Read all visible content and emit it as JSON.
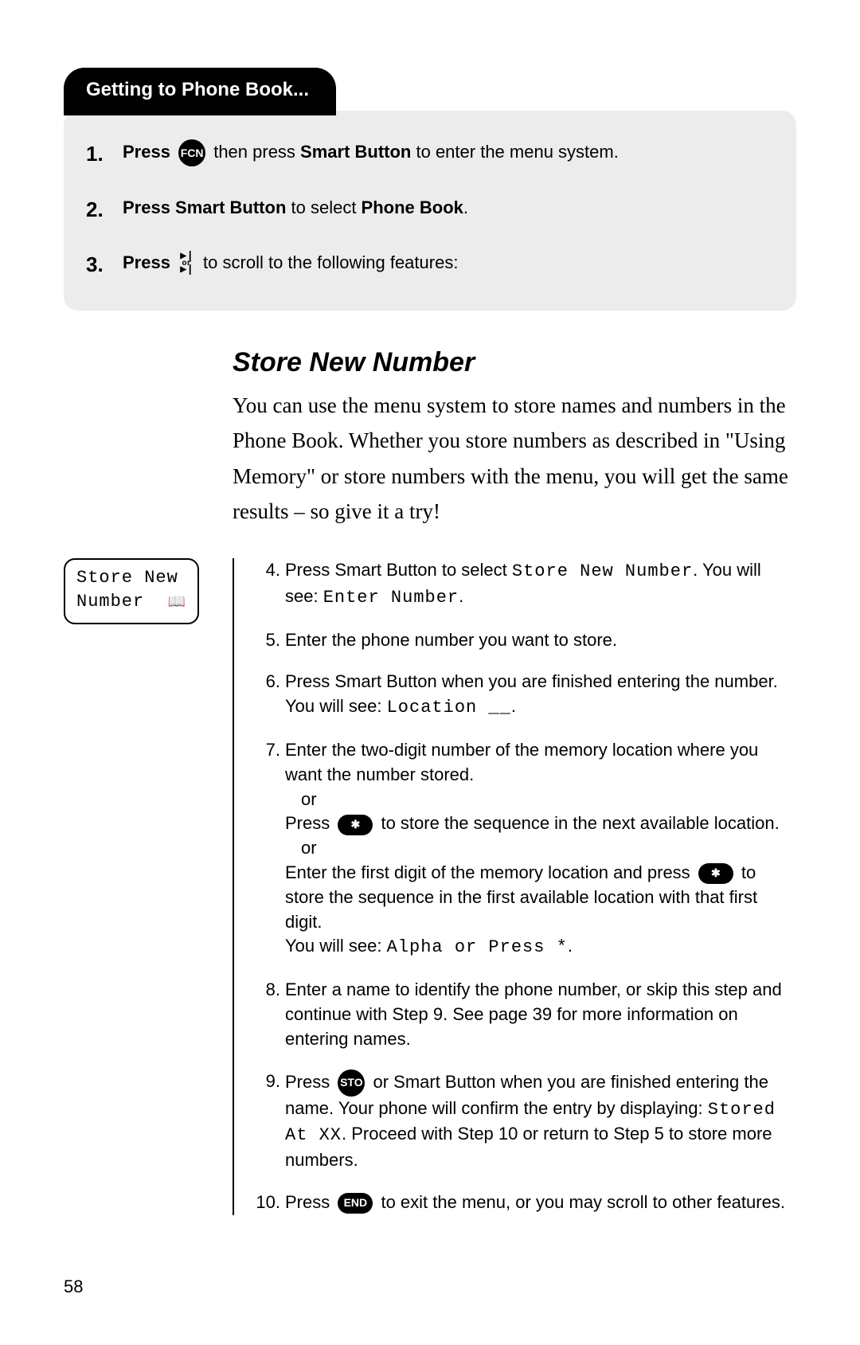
{
  "tab": "Getting to Phone Book...",
  "graybox": {
    "items": [
      {
        "num": "1.",
        "pre": "Press",
        "key": "FCN",
        "t1": " then press ",
        "b1": "Smart Button",
        "t2": " to enter the menu system."
      },
      {
        "num": "2.",
        "b0": "Press Smart Button",
        "t1": " to select ",
        "b1": "Phone Book",
        "t2": "."
      },
      {
        "num": "3.",
        "pre": "Press",
        "scroll_top": "▶|",
        "scroll_mid": "or",
        "scroll_bot": "▶|",
        "t1": " to scroll to the following features:"
      }
    ]
  },
  "section_title": "Store New Number",
  "lead": "You can use the menu system to store names and numbers in the Phone Book. Whether you store numbers as described in \"Using Memory\" or store numbers with the menu, you will get the same results – so give it a try!",
  "lcd": {
    "line1": "Store New",
    "line2": "Number",
    "icon": "📖"
  },
  "steps": [
    {
      "num": "4.",
      "parts": [
        {
          "t": "Press Smart Button to select "
        },
        {
          "mono": "Store New Number"
        },
        {
          "t": ". You will see: "
        },
        {
          "mono": "Enter Number"
        },
        {
          "t": "."
        }
      ]
    },
    {
      "num": "5.",
      "parts": [
        {
          "t": "Enter the phone number you want to store."
        }
      ]
    },
    {
      "num": "6.",
      "parts": [
        {
          "t": "Press Smart Button when you are finished entering the number."
        },
        {
          "br": true
        },
        {
          "t": "You will see: "
        },
        {
          "mono": "Location __"
        },
        {
          "t": "."
        }
      ]
    },
    {
      "num": "7.",
      "parts": [
        {
          "t": "Enter the two-digit number of the memory location where you want the number stored."
        },
        {
          "br": true
        },
        {
          "indent": "or"
        },
        {
          "t": "Press "
        },
        {
          "pill": "✱"
        },
        {
          "t": " to store the sequence in the next available location."
        },
        {
          "br": true
        },
        {
          "indent": "or"
        },
        {
          "t": "Enter the first digit of the memory location and press "
        },
        {
          "pill": "✱"
        },
        {
          "t": " to store the sequence in the first available location with that first digit."
        },
        {
          "br": true
        },
        {
          "t": "You will see: "
        },
        {
          "mono": "Alpha or Press *"
        },
        {
          "t": "."
        }
      ]
    },
    {
      "num": "8.",
      "parts": [
        {
          "t": "Enter a name to identify the phone number, or skip this step and continue with Step 9. See page 39 for more information on entering names."
        }
      ]
    },
    {
      "num": "9.",
      "parts": [
        {
          "t": "Press "
        },
        {
          "round": "STO"
        },
        {
          "t": " or Smart Button when you are finished entering the name. Your phone will confirm the entry by displaying: "
        },
        {
          "mono": "Stored At XX"
        },
        {
          "t": ". Proceed with Step 10 or return to Step 5 to store more numbers."
        }
      ]
    },
    {
      "num": "10.",
      "parts": [
        {
          "t": "Press "
        },
        {
          "pill": "END"
        },
        {
          "t": " to exit the menu, or you may scroll to other features."
        }
      ]
    }
  ],
  "page_number": "58"
}
